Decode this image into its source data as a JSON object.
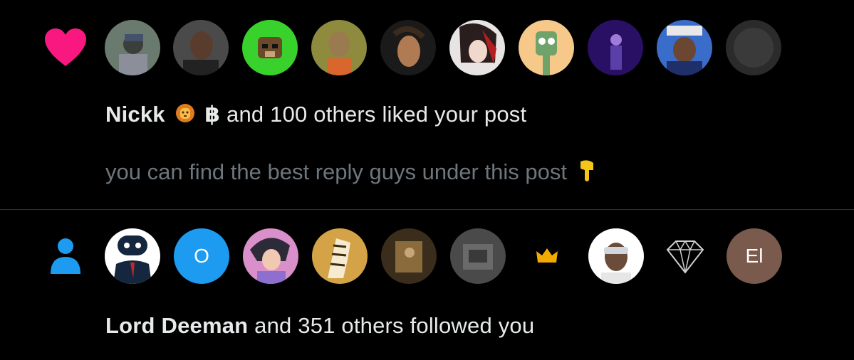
{
  "colors": {
    "background": "#000000",
    "text_primary": "#e7e9ea",
    "text_secondary": "#6e767d",
    "like_pink": "#f91880",
    "follow_blue": "#1d9bf0",
    "divider": "#2f3336"
  },
  "notifications": [
    {
      "type": "like",
      "icon": "heart-icon",
      "avatars": [
        {
          "name": "avatar-1",
          "initials": ""
        },
        {
          "name": "avatar-2",
          "initials": ""
        },
        {
          "name": "avatar-3",
          "initials": ""
        },
        {
          "name": "avatar-4",
          "initials": ""
        },
        {
          "name": "avatar-5",
          "initials": ""
        },
        {
          "name": "avatar-6",
          "initials": ""
        },
        {
          "name": "avatar-7",
          "initials": ""
        },
        {
          "name": "avatar-8",
          "initials": ""
        },
        {
          "name": "avatar-9",
          "initials": ""
        },
        {
          "name": "avatar-10",
          "initials": ""
        }
      ],
      "actor_name": "Nickk",
      "actor_badges": [
        "lion-emoji-icon",
        "bitcoin-icon"
      ],
      "bitcoin_glyph": "฿",
      "action_text": "and 100 others liked your post",
      "post_preview": "you can find the best reply guys under this post",
      "post_preview_emoji": "pointing-down-hand-icon"
    },
    {
      "type": "follow",
      "icon": "person-icon",
      "avatars": [
        {
          "name": "avatar-robot",
          "initials": ""
        },
        {
          "name": "avatar-blue-o",
          "initials": "O"
        },
        {
          "name": "avatar-anime",
          "initials": ""
        },
        {
          "name": "avatar-horse",
          "initials": ""
        },
        {
          "name": "avatar-photo",
          "initials": ""
        },
        {
          "name": "avatar-grey",
          "initials": ""
        },
        {
          "name": "avatar-crown",
          "initials": ""
        },
        {
          "name": "avatar-visor",
          "initials": ""
        },
        {
          "name": "avatar-diamond",
          "initials": ""
        },
        {
          "name": "avatar-el",
          "initials": "El"
        }
      ],
      "actor_name": "Lord Deeman",
      "action_text": "and 351 others followed you"
    }
  ]
}
